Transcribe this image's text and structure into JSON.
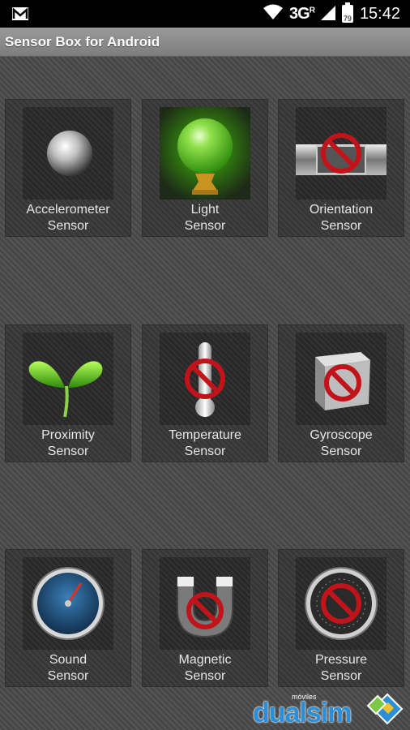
{
  "status_bar": {
    "network": "3G",
    "network_sup": "R",
    "battery": "79",
    "time": "15:42",
    "icons": [
      "mail-icon",
      "wifi-icon",
      "signal-icon",
      "battery-icon"
    ]
  },
  "app": {
    "title": "Sensor Box for Android"
  },
  "sensors": [
    {
      "line1": "Accelerometer",
      "line2": "Sensor",
      "icon": "metal-ball-icon",
      "available": true
    },
    {
      "line1": "Light",
      "line2": "Sensor",
      "icon": "green-light-bulb-icon",
      "available": true
    },
    {
      "line1": "Orientation",
      "line2": "Sensor",
      "icon": "spirit-level-icon",
      "available": false
    },
    {
      "line1": "Proximity",
      "line2": "Sensor",
      "icon": "sprout-icon",
      "available": true
    },
    {
      "line1": "Temperature",
      "line2": "Sensor",
      "icon": "thermometer-icon",
      "available": false
    },
    {
      "line1": "Gyroscope",
      "line2": "Sensor",
      "icon": "cube-icon",
      "available": false
    },
    {
      "line1": "Sound",
      "line2": "Sensor",
      "icon": "gauge-icon",
      "available": true
    },
    {
      "line1": "Magnetic",
      "line2": "Sensor",
      "icon": "magnet-icon",
      "available": false
    },
    {
      "line1": "Pressure",
      "line2": "Sensor",
      "icon": "pressure-gauge-icon",
      "available": false
    }
  ],
  "watermark": {
    "small": "móviles",
    "word": "dualsim"
  },
  "colors": {
    "unavailable": "#c0141a",
    "light_green": "#57c61f",
    "gauge_blue": "#1e4f7a",
    "brand_blue": "#2a8fd8"
  }
}
